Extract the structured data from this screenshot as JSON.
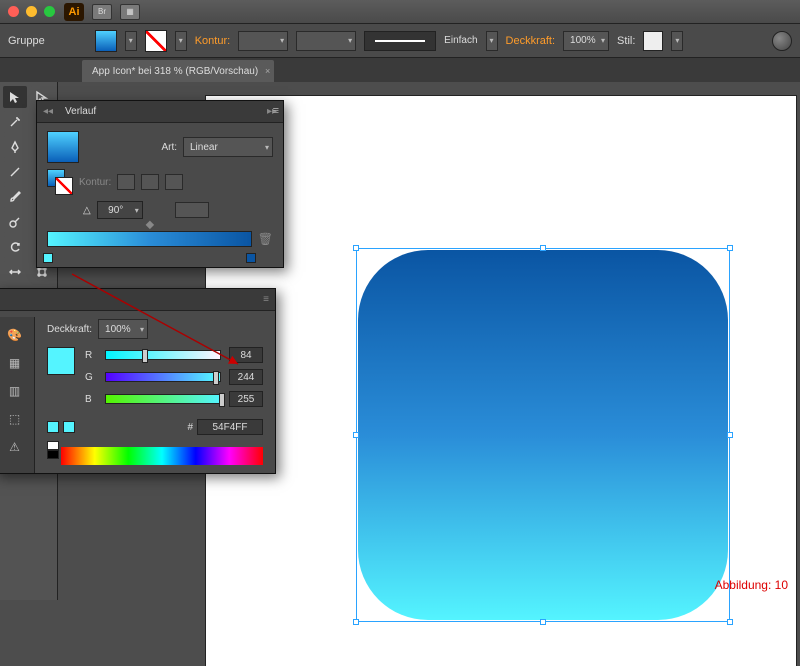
{
  "traffic": {
    "close": "#ff5f57",
    "min": "#febc2e",
    "max": "#28c840"
  },
  "app_logo": "Ai",
  "control_bar": {
    "group_label": "Gruppe",
    "kontur_label": "Kontur:",
    "kontur_value": "",
    "brush_label": "Einfach",
    "deckkraft_label": "Deckkraft:",
    "deckkraft_value": "100%",
    "stil_label": "Stil:"
  },
  "doc_tab": "App Icon* bei 318 % (RGB/Vorschau)",
  "gradient_panel": {
    "title": "Verlauf",
    "art_label": "Art:",
    "art_value": "Linear",
    "kontur_label": "Kontur:",
    "angle_label": "△",
    "angle_value": "90°"
  },
  "color_panel": {
    "deckkraft_label": "Deckkraft:",
    "deckkraft_value": "100%",
    "labels": {
      "r": "R",
      "g": "G",
      "b": "B"
    },
    "values": {
      "r": "84",
      "g": "244",
      "b": "255"
    },
    "hex_prefix": "#",
    "hex": "54F4FF"
  },
  "figure_label": "Abbildung: 10"
}
